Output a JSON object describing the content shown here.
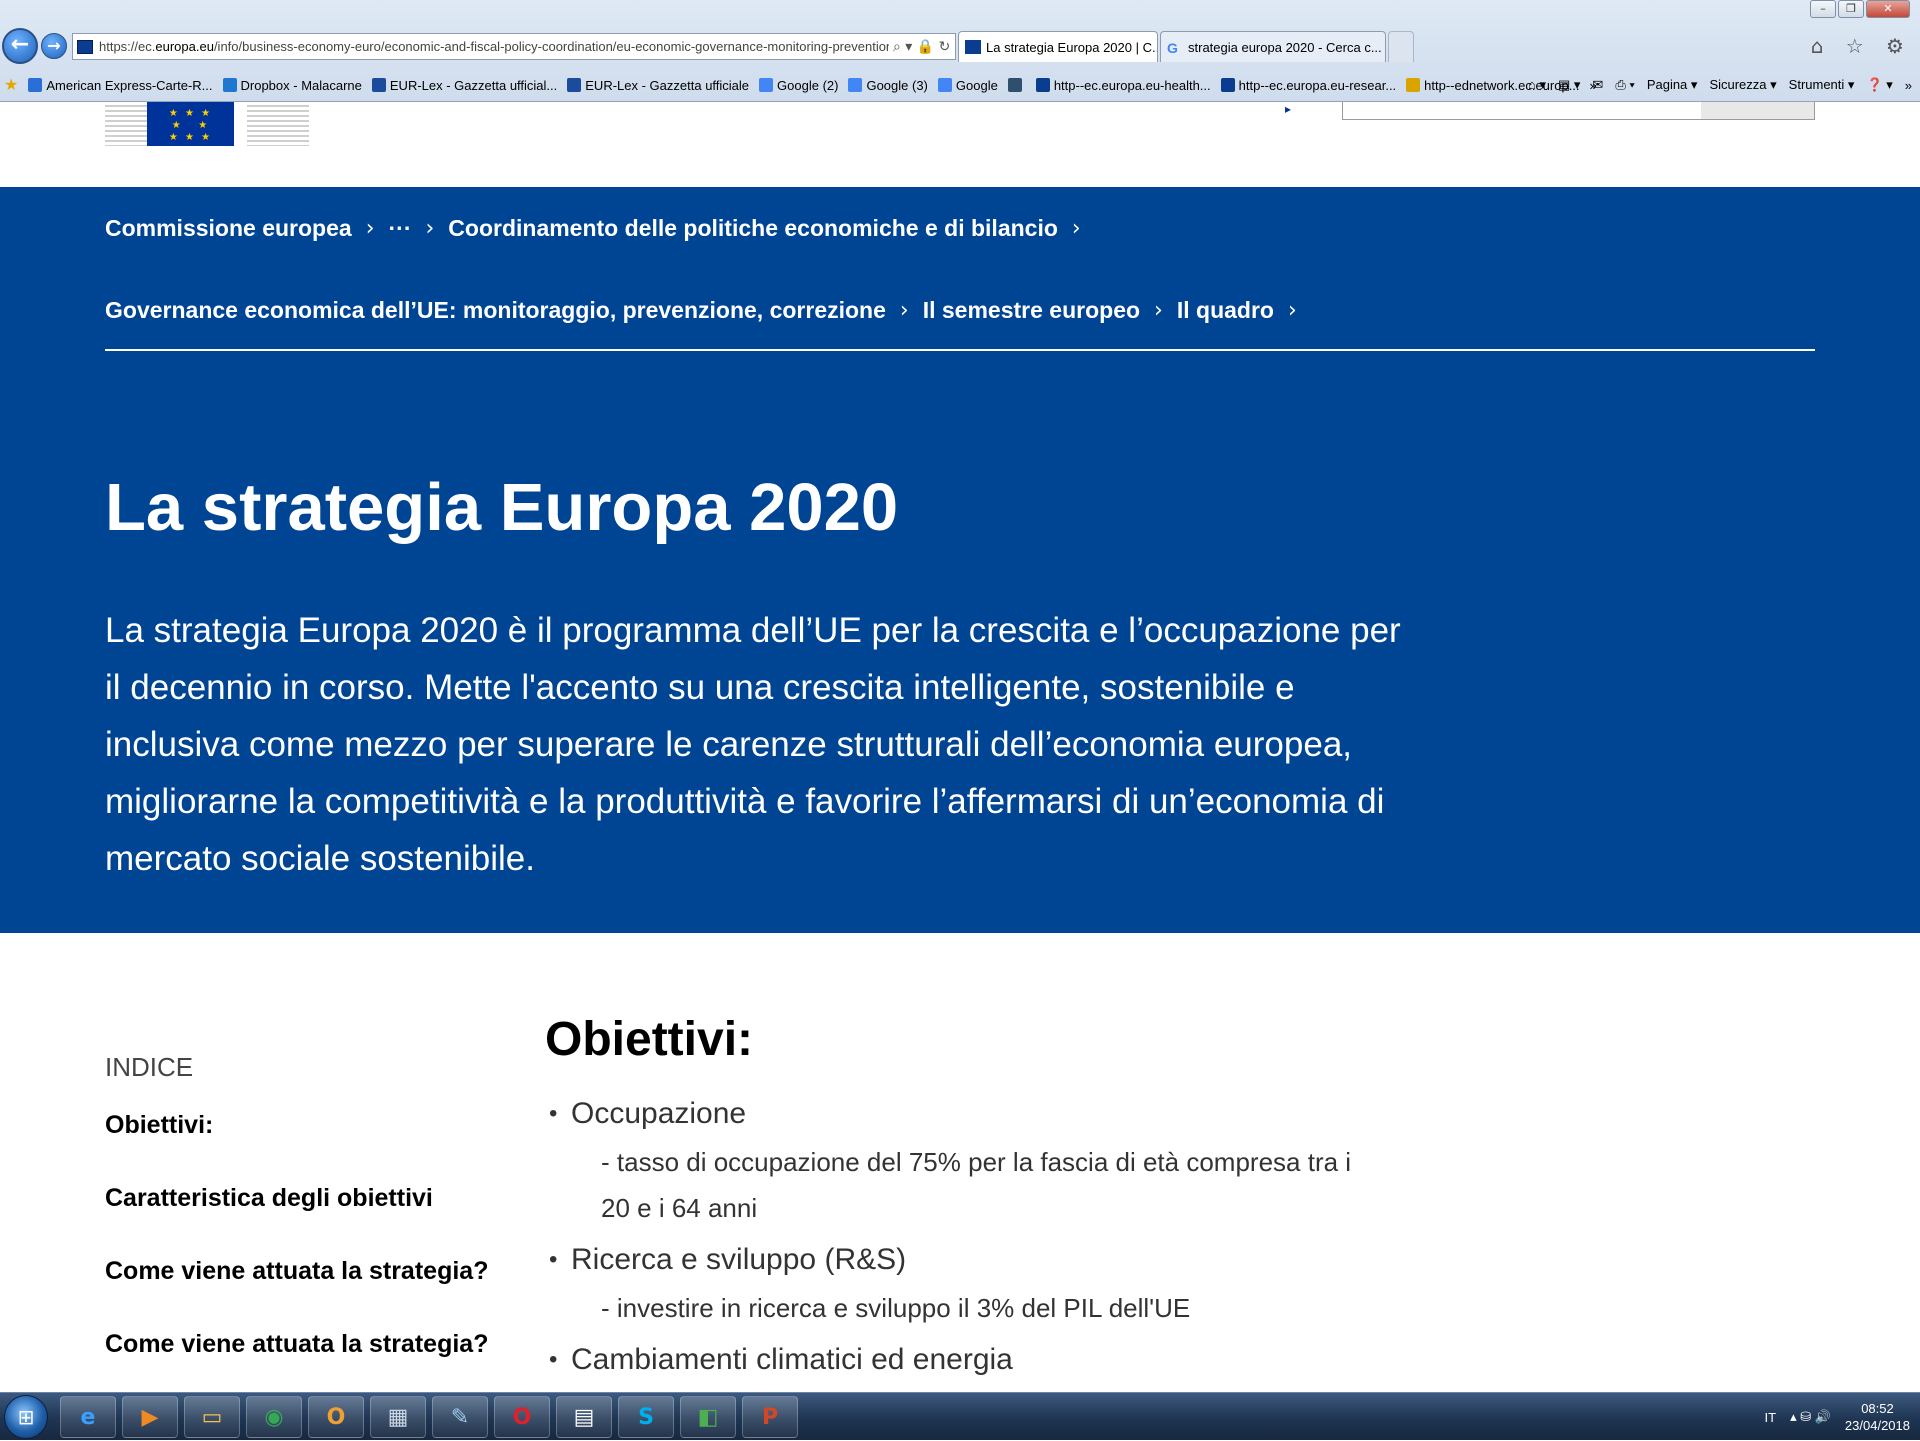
{
  "browser": {
    "address": {
      "url_host_prefix": "https://ec.",
      "url_host": "europa.eu",
      "url_path": "/info/business-economy-euro/economic-and-fiscal-policy-coordination/eu-economic-governance-monitoring-prevention-corr",
      "icons": "⌕ ▾ 🔒 ↻"
    },
    "tabs": [
      {
        "title": "La strategia Europa 2020 | C...",
        "close": "×",
        "favicon_color": "#0a3d8f"
      },
      {
        "title": "strategia europa 2020 - Cerca c...",
        "favicon_color": "#4285f4"
      }
    ],
    "right_icons": "⌂ ☆ ⚙",
    "window_controls": [
      "–",
      "❐",
      "✕"
    ],
    "favorites": [
      {
        "label": "American Express-Carte-R...",
        "color": "#2a6fd6"
      },
      {
        "label": "Dropbox - Malacarne",
        "color": "#1f77d0"
      },
      {
        "label": "EUR-Lex - Gazzetta ufficial...",
        "color": "#1a4b9c"
      },
      {
        "label": "EUR-Lex - Gazzetta ufficiale",
        "color": "#1a4b9c"
      },
      {
        "label": "Google (2)",
        "color": "#4285f4"
      },
      {
        "label": "Google (3)",
        "color": "#4285f4"
      },
      {
        "label": "Google",
        "color": "#4285f4"
      },
      {
        "label": "",
        "color": "#2f4f6f"
      },
      {
        "label": "http--ec.europa.eu-health...",
        "color": "#0a3d8f"
      },
      {
        "label": "http--ec.europa.eu-resear...",
        "color": "#0a3d8f"
      },
      {
        "label": "http--ednetwork.ec.europ...",
        "color": "#d9a300"
      }
    ],
    "favorites_overflow": "»",
    "toolbar": {
      "home_icon": "⌂ ▾",
      "feeds_icon": "▤ ▾",
      "mail_icon": "✉",
      "print_icon": "⎙ ▾",
      "pagina": "Pagina ▾",
      "sicurezza": "Sicurezza ▾",
      "strumenti": "Strumenti ▾",
      "help": "❓ ▾",
      "overflow": "»"
    }
  },
  "page": {
    "logo_stars": "★ ★ ★\n★     ★\n★ ★ ★",
    "header_arrow": "▸",
    "breadcrumbs_row1": [
      "Commissione europea",
      "···",
      "Coordinamento delle politiche economiche e di bilancio"
    ],
    "breadcrumbs_row2": [
      "Governance economica dell’UE: monitoraggio, prevenzione, correzione",
      "Il semestre europeo",
      "Il quadro"
    ],
    "crumb_separator": "›",
    "title": "La strategia Europa 2020",
    "intro": "La strategia Europa 2020 è il programma dell’UE per la crescita e l’occupazione per il decennio in corso. Mette l'accento su una crescita intelligente, sostenibile e inclusiva come mezzo per superare le carenze strutturali dell’economia europea, migliorarne la competitività e la produttività e favorire l’affermarsi di un’economia di mercato sociale sostenibile.",
    "toc": {
      "heading": "INDICE",
      "items": [
        "Obiettivi:",
        "Caratteristica degli obiettivi",
        "Come viene attuata la strategia?",
        "Come viene attuata la strategia?"
      ]
    },
    "section": {
      "title": "Obiettivi:",
      "objectives": [
        {
          "label": "Occupazione",
          "detail": "- tasso di occupazione del 75% per la fascia di età compresa tra i 20 e i 64 anni"
        },
        {
          "label": "Ricerca e sviluppo (R&S)",
          "detail": "- investire in ricerca e sviluppo il 3% del PIL dell'UE"
        },
        {
          "label": "Cambiamenti climatici ed energia",
          "detail": ""
        }
      ]
    }
  },
  "taskbar": {
    "start_icon": "⊞",
    "apps": [
      {
        "name": "internet-explorer",
        "glyph": "e",
        "color": "#3aa0ff"
      },
      {
        "name": "media-player",
        "glyph": "▶",
        "color": "#f08a24"
      },
      {
        "name": "file-explorer",
        "glyph": "▭",
        "color": "#f2c14e"
      },
      {
        "name": "chrome",
        "glyph": "◉",
        "color": "#34a853"
      },
      {
        "name": "outlook",
        "glyph": "O",
        "color": "#f0a030"
      },
      {
        "name": "calculator",
        "glyph": "▦",
        "color": "#c9d6e6"
      },
      {
        "name": "notes",
        "glyph": "✎",
        "color": "#9ec9ef"
      },
      {
        "name": "opera",
        "glyph": "O",
        "color": "#e0202a"
      },
      {
        "name": "document",
        "glyph": "▤",
        "color": "#ffffff"
      },
      {
        "name": "skype",
        "glyph": "S",
        "color": "#00aff0"
      },
      {
        "name": "green-app",
        "glyph": "◧",
        "color": "#4caf50"
      },
      {
        "name": "powerpoint",
        "glyph": "P",
        "color": "#d24726"
      }
    ],
    "tray": {
      "language": "IT",
      "icons": "▴ ⛁ 🔊",
      "time": "08:52",
      "date": "23/04/2018"
    }
  }
}
